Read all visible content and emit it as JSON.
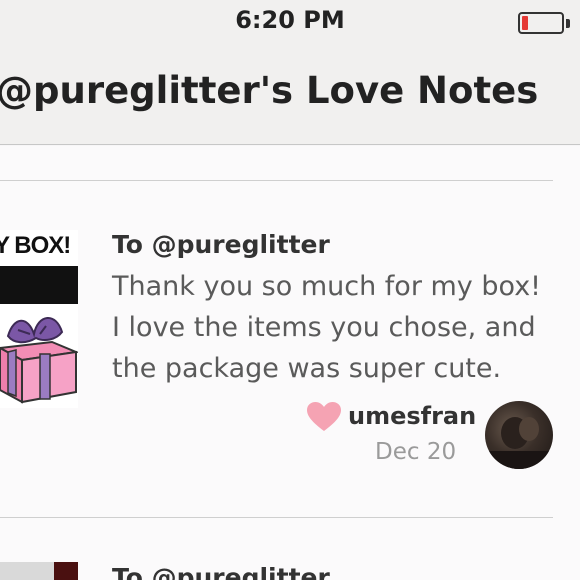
{
  "status_bar": {
    "time": "6:20 PM",
    "battery_level": 0.15,
    "battery_color": "#e53935"
  },
  "header": {
    "title": "@pureglitter's Love Notes"
  },
  "notes": [
    {
      "thumbnail_text": "Y BOX!",
      "to": "To @pureglitter",
      "body": "Thank you so much for my box! I love the items you chose, and the package was super cute.",
      "username": "umesfran",
      "date": "Dec 20",
      "like_icon": "heart-icon",
      "like_color": "#f5a3b3"
    },
    {
      "to": "To @pureglitter"
    }
  ]
}
